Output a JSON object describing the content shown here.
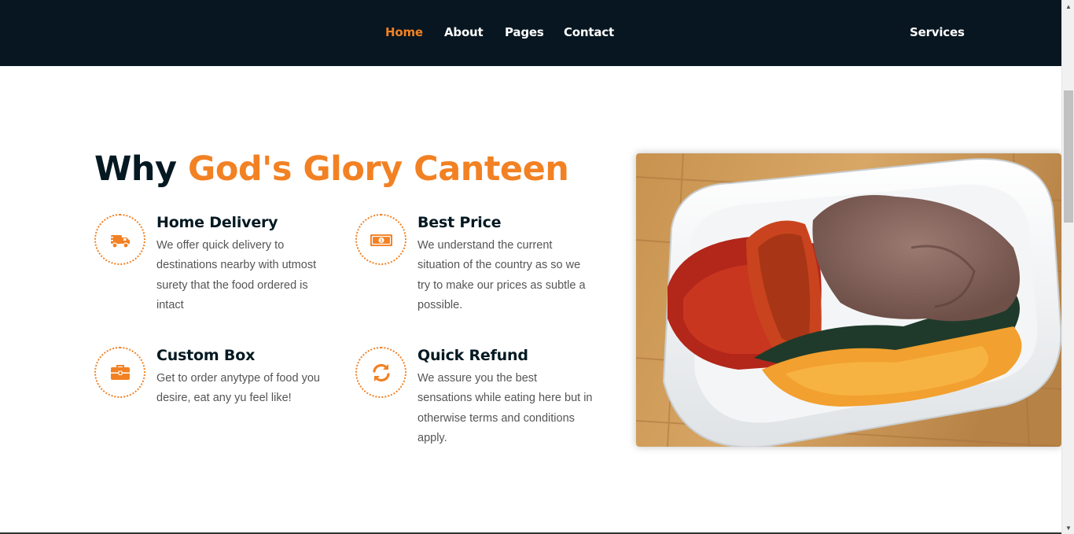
{
  "nav": {
    "items": [
      {
        "label": "Home",
        "active": true
      },
      {
        "label": "About",
        "active": false
      },
      {
        "label": "Pages",
        "active": false
      },
      {
        "label": "Contact",
        "active": false
      }
    ],
    "services_label": "Services"
  },
  "section": {
    "title_prefix": "Why ",
    "title_accent": "God's Glory Canteen",
    "features": [
      {
        "icon": "delivery-truck-icon",
        "heading": "Home Delivery",
        "text": "We offer quick delivery to destinations nearby with utmost surety that the food ordered is intact"
      },
      {
        "icon": "money-bill-icon",
        "heading": "Best Price",
        "text": "We understand the current situation of the country as so we try to make our prices as subtle a possible."
      },
      {
        "icon": "briefcase-icon",
        "heading": "Custom Box",
        "text": "Get to order anytype of food you desire, eat any yu feel like!"
      },
      {
        "icon": "refresh-icon",
        "heading": "Quick Refund",
        "text": "We assure you the best sensations while eating here but in otherwise terms and conditions apply."
      }
    ]
  },
  "colors": {
    "accent": "#f28123",
    "dark": "#051922",
    "navbar": "#071620"
  }
}
